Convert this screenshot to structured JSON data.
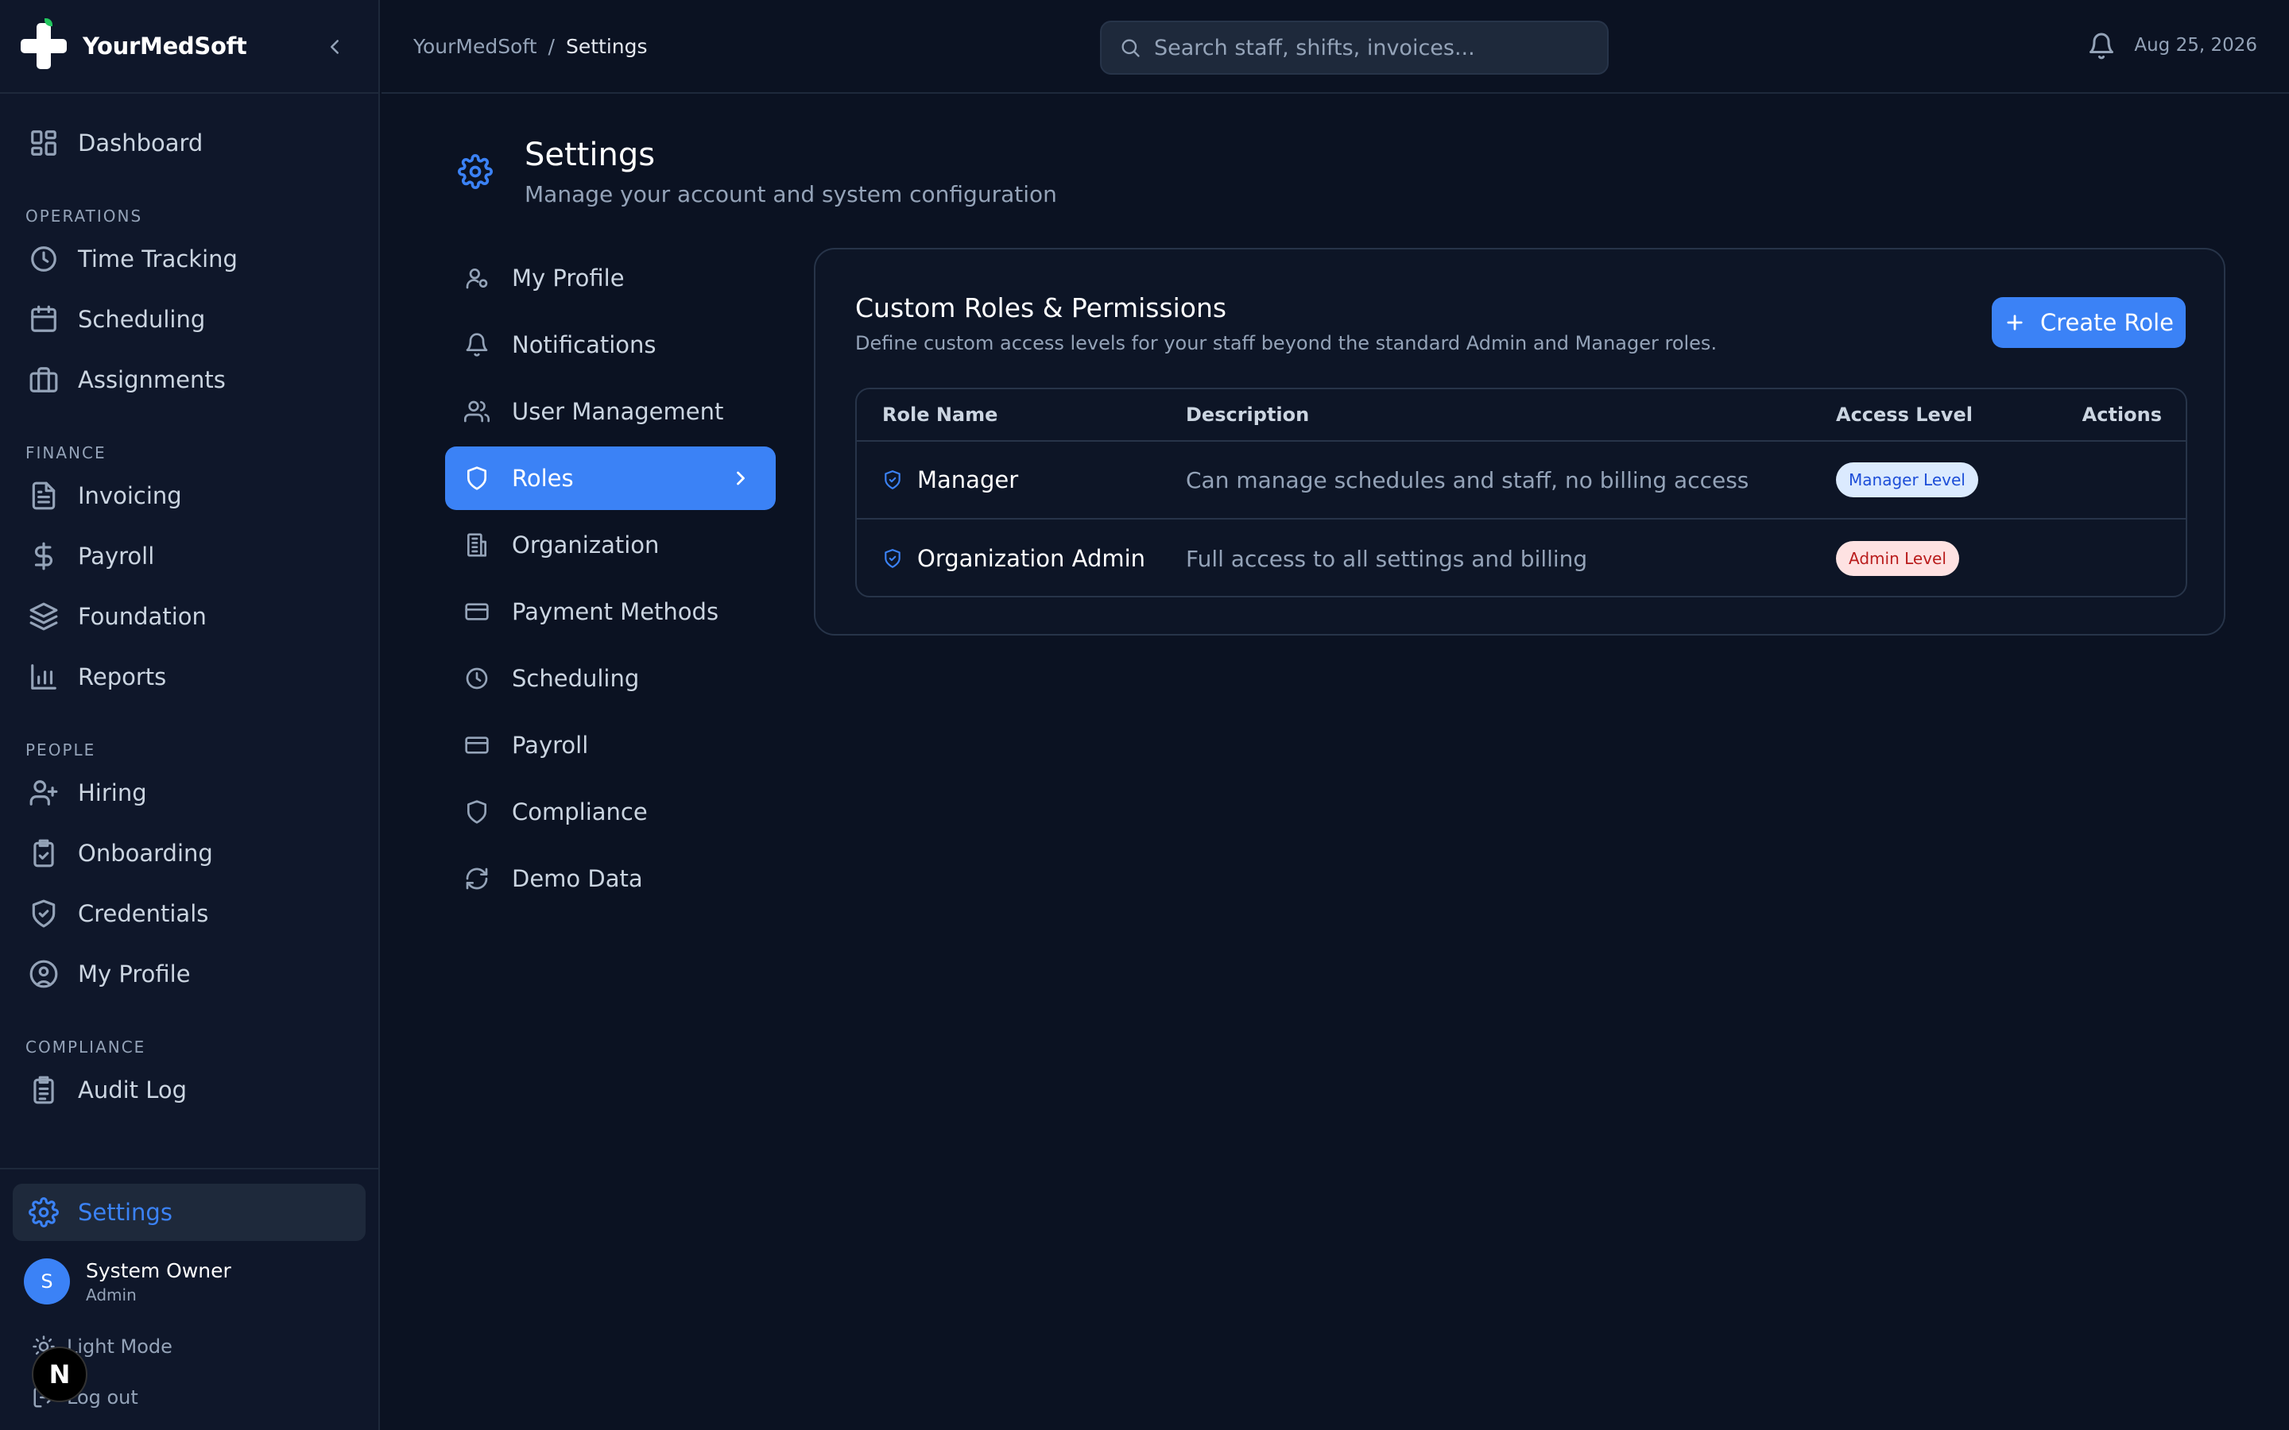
{
  "brand": {
    "name": "YourMedSoft"
  },
  "sidebar": {
    "items": [
      {
        "label": "Dashboard",
        "icon": "grid-icon"
      }
    ],
    "sections": [
      {
        "title": "OPERATIONS",
        "items": [
          {
            "label": "Time Tracking",
            "icon": "clock-icon"
          },
          {
            "label": "Scheduling",
            "icon": "calendar-icon"
          },
          {
            "label": "Assignments",
            "icon": "briefcase-icon"
          }
        ]
      },
      {
        "title": "FINANCE",
        "items": [
          {
            "label": "Invoicing",
            "icon": "document-icon"
          },
          {
            "label": "Payroll",
            "icon": "dollar-icon"
          },
          {
            "label": "Foundation",
            "icon": "layers-icon"
          },
          {
            "label": "Reports",
            "icon": "bar-chart-icon"
          }
        ]
      },
      {
        "title": "PEOPLE",
        "items": [
          {
            "label": "Hiring",
            "icon": "user-plus-icon"
          },
          {
            "label": "Onboarding",
            "icon": "clipboard-check-icon"
          },
          {
            "label": "Credentials",
            "icon": "shield-check-icon"
          },
          {
            "label": "My Profile",
            "icon": "user-circle-icon"
          }
        ]
      },
      {
        "title": "COMPLIANCE",
        "items": [
          {
            "label": "Audit Log",
            "icon": "clipboard-list-icon"
          }
        ]
      }
    ],
    "settings_label": "Settings",
    "user": {
      "initial": "S",
      "name": "System Owner",
      "role": "Admin"
    },
    "light_mode_label": "Light Mode",
    "logout_label": "Log out",
    "next_badge": "N"
  },
  "header": {
    "breadcrumb": [
      "YourMedSoft",
      "Settings"
    ],
    "breadcrumb_sep": "/",
    "search_placeholder": "Search staff, shifts, invoices...",
    "date": "Aug 25, 2026"
  },
  "page": {
    "title": "Settings",
    "subtitle": "Manage your account and system configuration"
  },
  "settings_nav": [
    {
      "label": "My Profile",
      "icon": "user-icon",
      "active": false
    },
    {
      "label": "Notifications",
      "icon": "bell-icon",
      "active": false
    },
    {
      "label": "User Management",
      "icon": "users-icon",
      "active": false
    },
    {
      "label": "Roles",
      "icon": "shield-icon",
      "active": true
    },
    {
      "label": "Organization",
      "icon": "building-icon",
      "active": false
    },
    {
      "label": "Payment Methods",
      "icon": "credit-card-icon",
      "active": false
    },
    {
      "label": "Scheduling",
      "icon": "clock-icon",
      "active": false
    },
    {
      "label": "Payroll",
      "icon": "credit-card-icon",
      "active": false
    },
    {
      "label": "Compliance",
      "icon": "shield-icon",
      "active": false
    },
    {
      "label": "Demo Data",
      "icon": "refresh-icon",
      "active": false
    }
  ],
  "roles_card": {
    "title": "Custom Roles & Permissions",
    "subtitle": "Define custom access levels for your staff beyond the standard Admin and Manager roles.",
    "create_label": "Create Role",
    "columns": [
      "Role Name",
      "Description",
      "Access Level",
      "Actions"
    ],
    "rows": [
      {
        "name": "Manager",
        "description": "Can manage schedules and staff, no billing access",
        "access": "Manager Level",
        "access_kind": "manager"
      },
      {
        "name": "Organization Admin",
        "description": "Full access to all settings and billing",
        "access": "Admin Level",
        "access_kind": "admin"
      }
    ]
  },
  "colors": {
    "accent": "#3b82f6",
    "background": "#0b1222",
    "sidebar": "#0f172a",
    "manager_badge": "#dbeafe",
    "admin_badge": "#fee2e2"
  }
}
